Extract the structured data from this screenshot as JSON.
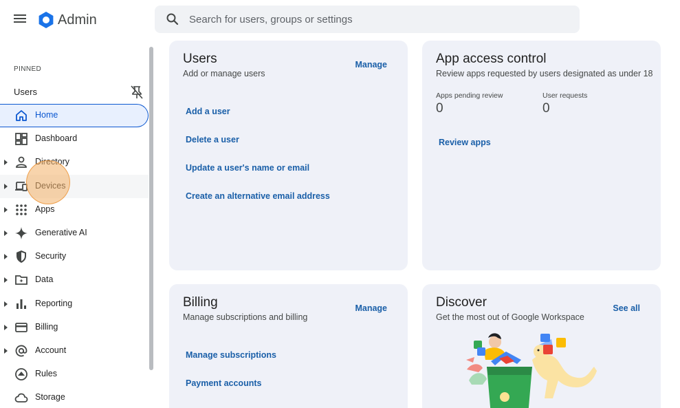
{
  "header": {
    "brand": "Admin",
    "search_placeholder": "Search for users, groups or settings"
  },
  "sidebar": {
    "pinned_heading": "PINNED",
    "pinned_items": [
      "Users"
    ],
    "items": [
      {
        "label": "Home",
        "icon": "home-icon",
        "expandable": false,
        "active": true
      },
      {
        "label": "Dashboard",
        "icon": "dashboard-icon",
        "expandable": false
      },
      {
        "label": "Directory",
        "icon": "person-icon",
        "expandable": true
      },
      {
        "label": "Devices",
        "icon": "devices-icon",
        "expandable": true,
        "hover": true
      },
      {
        "label": "Apps",
        "icon": "apps-grid-icon",
        "expandable": true
      },
      {
        "label": "Generative AI",
        "icon": "sparkle-icon",
        "expandable": true
      },
      {
        "label": "Security",
        "icon": "shield-icon",
        "expandable": true
      },
      {
        "label": "Data",
        "icon": "data-folder-icon",
        "expandable": true
      },
      {
        "label": "Reporting",
        "icon": "bar-chart-icon",
        "expandable": true
      },
      {
        "label": "Billing",
        "icon": "credit-card-icon",
        "expandable": true
      },
      {
        "label": "Account",
        "icon": "at-sign-icon",
        "expandable": true
      },
      {
        "label": "Rules",
        "icon": "rules-icon",
        "expandable": false
      },
      {
        "label": "Storage",
        "icon": "cloud-icon",
        "expandable": false
      }
    ]
  },
  "cards": {
    "users": {
      "title": "Users",
      "subtitle": "Add or manage users",
      "action": "Manage",
      "links": [
        "Add a user",
        "Delete a user",
        "Update a user's name or email",
        "Create an alternative email address"
      ]
    },
    "app_access": {
      "title": "App access control",
      "subtitle": "Review apps requested by users designated as under 18",
      "stats": [
        {
          "label": "Apps pending review",
          "value": "0"
        },
        {
          "label": "User requests",
          "value": "0"
        }
      ],
      "action": "Review apps"
    },
    "billing": {
      "title": "Billing",
      "subtitle": "Manage subscriptions and billing",
      "action": "Manage",
      "links": [
        "Manage subscriptions",
        "Payment accounts"
      ]
    },
    "discover": {
      "title": "Discover",
      "subtitle": "Get the most out of Google Workspace",
      "action": "See all"
    }
  },
  "colors": {
    "accent": "#0b57d0",
    "link": "#1a5fa8",
    "card_bg": "#eff1f8",
    "highlight": "#f3b068"
  }
}
